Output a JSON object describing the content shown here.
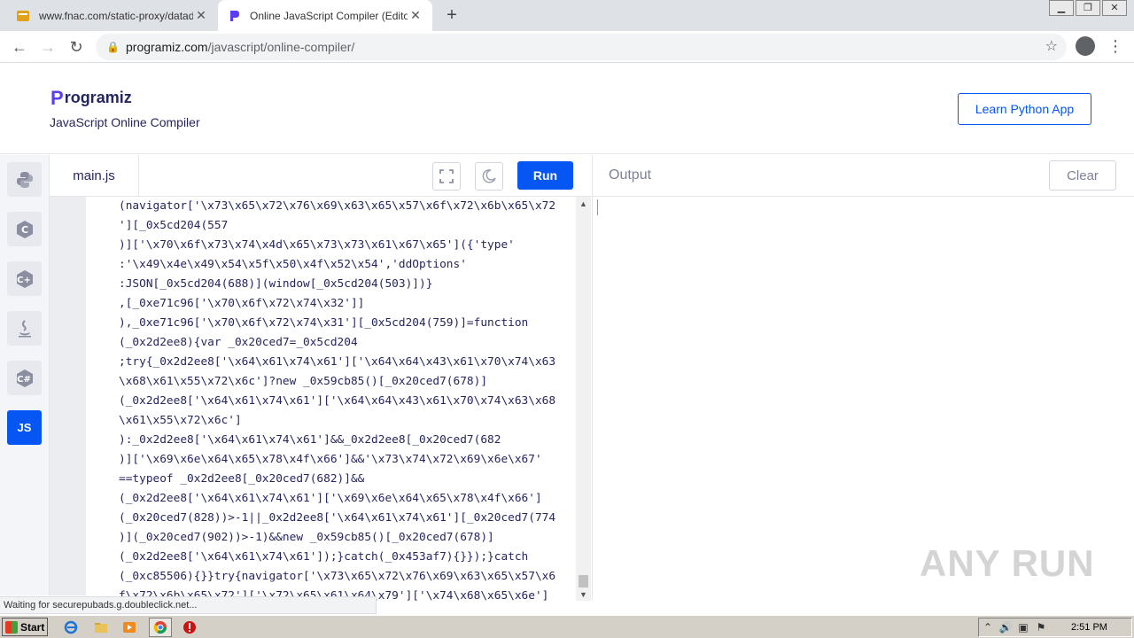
{
  "browser": {
    "tabs": [
      {
        "title": "www.fnac.com/static-proxy/datadom",
        "active": false
      },
      {
        "title": "Online JavaScript Compiler (Editor)",
        "active": true
      }
    ],
    "new_tab": "+",
    "url_domain": "programiz.com",
    "url_path": "/javascript/online-compiler/"
  },
  "site": {
    "logo": "rogramiz",
    "logo_mark": "P",
    "subtitle": "JavaScript Online Compiler",
    "learn_button": "Learn Python App"
  },
  "languages": [
    {
      "name": "python",
      "glyph": "🐍"
    },
    {
      "name": "c",
      "glyph": "C"
    },
    {
      "name": "cpp",
      "glyph": "C"
    },
    {
      "name": "java",
      "glyph": "♨"
    },
    {
      "name": "csharp",
      "glyph": "C"
    },
    {
      "name": "javascript",
      "glyph": "JS"
    }
  ],
  "editor": {
    "filename": "main.js",
    "run_label": "Run",
    "code_lines": [
      "(navigator['\\x73\\x65\\x72\\x76\\x69\\x63\\x65\\x57\\x6f\\x72\\x6b\\x65\\x72",
      "'][_0x5cd204(557",
      ")]['\\x70\\x6f\\x73\\x74\\x4d\\x65\\x73\\x73\\x61\\x67\\x65']({'type'",
      ":'\\x49\\x4e\\x49\\x54\\x5f\\x50\\x4f\\x52\\x54','ddOptions'",
      ":JSON[_0x5cd204(688)](window[_0x5cd204(503)])}",
      ",[_0xe71c96['\\x70\\x6f\\x72\\x74\\x32']]",
      "),_0xe71c96['\\x70\\x6f\\x72\\x74\\x31'][_0x5cd204(759)]=function",
      "(_0x2d2ee8){var _0x20ced7=_0x5cd204",
      ";try{_0x2d2ee8['\\x64\\x61\\x74\\x61']['\\x64\\x64\\x43\\x61\\x70\\x74\\x63",
      "\\x68\\x61\\x55\\x72\\x6c']?new _0x59cb85()[_0x20ced7(678)]",
      "(_0x2d2ee8['\\x64\\x61\\x74\\x61']['\\x64\\x64\\x43\\x61\\x70\\x74\\x63\\x68",
      "\\x61\\x55\\x72\\x6c']",
      "):_0x2d2ee8['\\x64\\x61\\x74\\x61']&&_0x2d2ee8[_0x20ced7(682",
      ")]['\\x69\\x6e\\x64\\x65\\x78\\x4f\\x66']&&'\\x73\\x74\\x72\\x69\\x6e\\x67'",
      "==typeof _0x2d2ee8[_0x20ced7(682)]&&",
      "(_0x2d2ee8['\\x64\\x61\\x74\\x61']['\\x69\\x6e\\x64\\x65\\x78\\x4f\\x66']",
      "(_0x20ced7(828))>-1||_0x2d2ee8['\\x64\\x61\\x74\\x61'][_0x20ced7(774",
      ")](_0x20ced7(902))>-1)&&new _0x59cb85()[_0x20ced7(678)]",
      "(_0x2d2ee8['\\x64\\x61\\x74\\x61']);}catch(_0x453af7){}});}catch",
      "(_0xc85506){}}try{navigator['\\x73\\x65\\x72\\x76\\x69\\x63\\x65\\x57\\x6",
      "f\\x72\\x6b\\x65\\x72']['\\x72\\x65\\x61\\x64\\x79']['\\x74\\x68\\x65\\x6e']"
    ]
  },
  "output": {
    "title": "Output",
    "clear_label": "Clear"
  },
  "status": {
    "text": "Waiting for securepubads.g.doubleclick.net..."
  },
  "watermark": "ANY RUN",
  "taskbar": {
    "start_label": "Start",
    "clock": "2:51 PM"
  },
  "colors": {
    "accent": "#0556f3",
    "brand_text": "#25265e",
    "muted": "#7d8193"
  }
}
